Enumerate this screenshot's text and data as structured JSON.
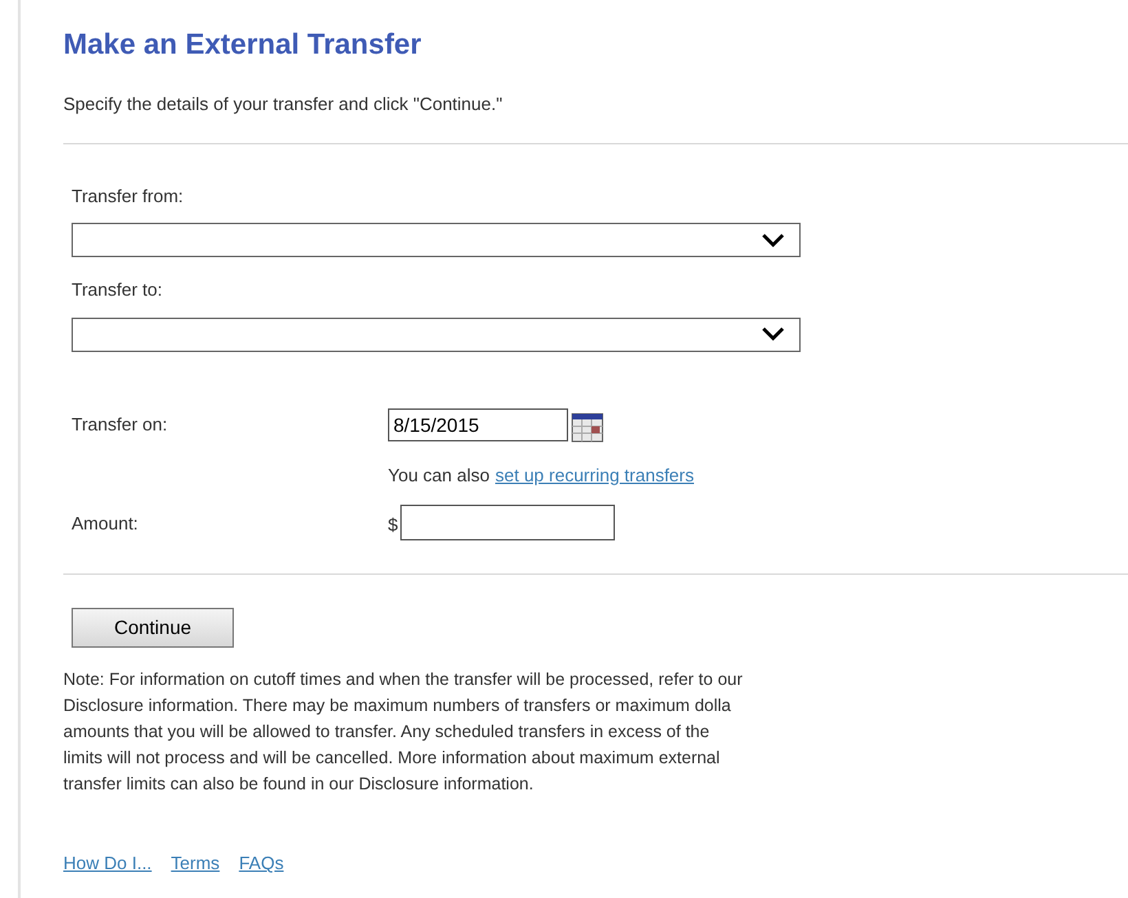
{
  "title": "Make an External Transfer",
  "intro": "Specify the details of your transfer and click \"Continue.\"",
  "selects": [
    {
      "label": "Transfer from:"
    },
    {
      "label": "Transfer to:"
    }
  ],
  "transfer_on": {
    "label": "Transfer on:",
    "value": "8/15/2015"
  },
  "recurring": {
    "text": "You can also",
    "link": "set up recurring transfers"
  },
  "amount": {
    "label": "Amount:",
    "currency": "$"
  },
  "continue_button": "Continue",
  "note_lines": [
    "Note: For information on cutoff times and when the transfer will be processed, refer to our",
    "Disclosure information. There may be maximum numbers of transfers or maximum dolla",
    "amounts that you will be allowed to transfer. Any scheduled transfers in excess of the",
    "limits will not process and will be cancelled. More information about maximum external",
    "transfer limits can also be found in our Disclosure information."
  ],
  "footer_links": [
    "How Do I...",
    "Terms",
    "FAQs"
  ]
}
